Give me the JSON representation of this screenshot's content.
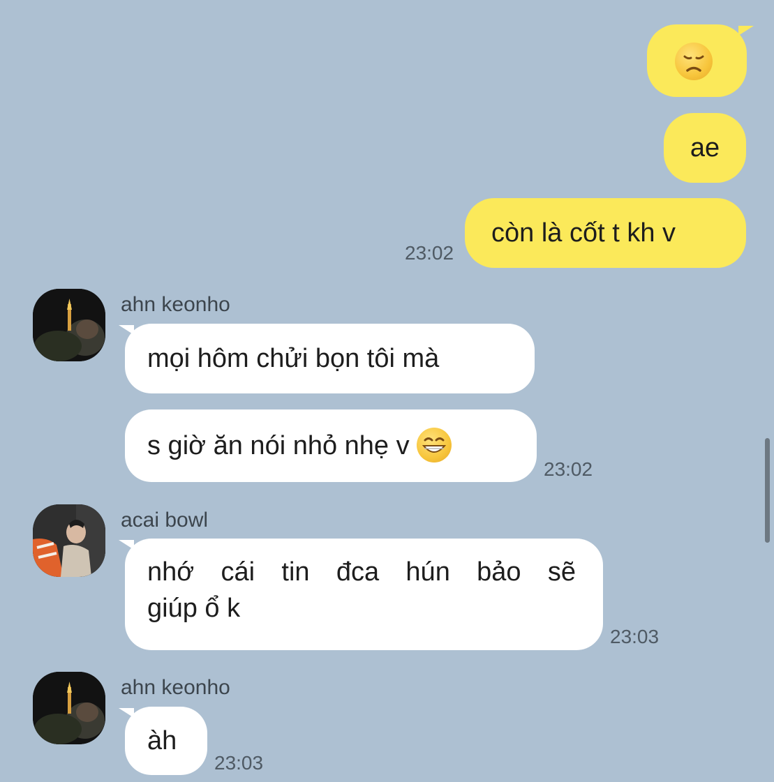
{
  "outgoing": [
    {
      "text": "",
      "emoji": "disappointed-face"
    },
    {
      "text": "ae"
    },
    {
      "text": "còn là cốt t kh v"
    }
  ],
  "outgoing_time": "23:02",
  "groups": [
    {
      "sender": "ahn keonho",
      "avatar": "night-tower-photo",
      "messages": [
        "mọi hôm chửi bọn tôi mà",
        "s giờ ăn nói nhỏ nhẹ v"
      ],
      "trailing_emoji": "grinning-face",
      "time": "23:02"
    },
    {
      "sender": "acai bowl",
      "avatar": "orange-jacket-photo",
      "messages": [
        "nhớ cái tin đca hún bảo sẽ",
        "giúp ổ k"
      ],
      "time": "23:03"
    },
    {
      "sender": "ahn keonho",
      "avatar": "night-tower-photo",
      "messages": [
        "àh"
      ],
      "time": "23:03"
    }
  ],
  "colors": {
    "background": "#adc0d2",
    "outgoing_bubble": "#fbe95a",
    "incoming_bubble": "#ffffff"
  }
}
